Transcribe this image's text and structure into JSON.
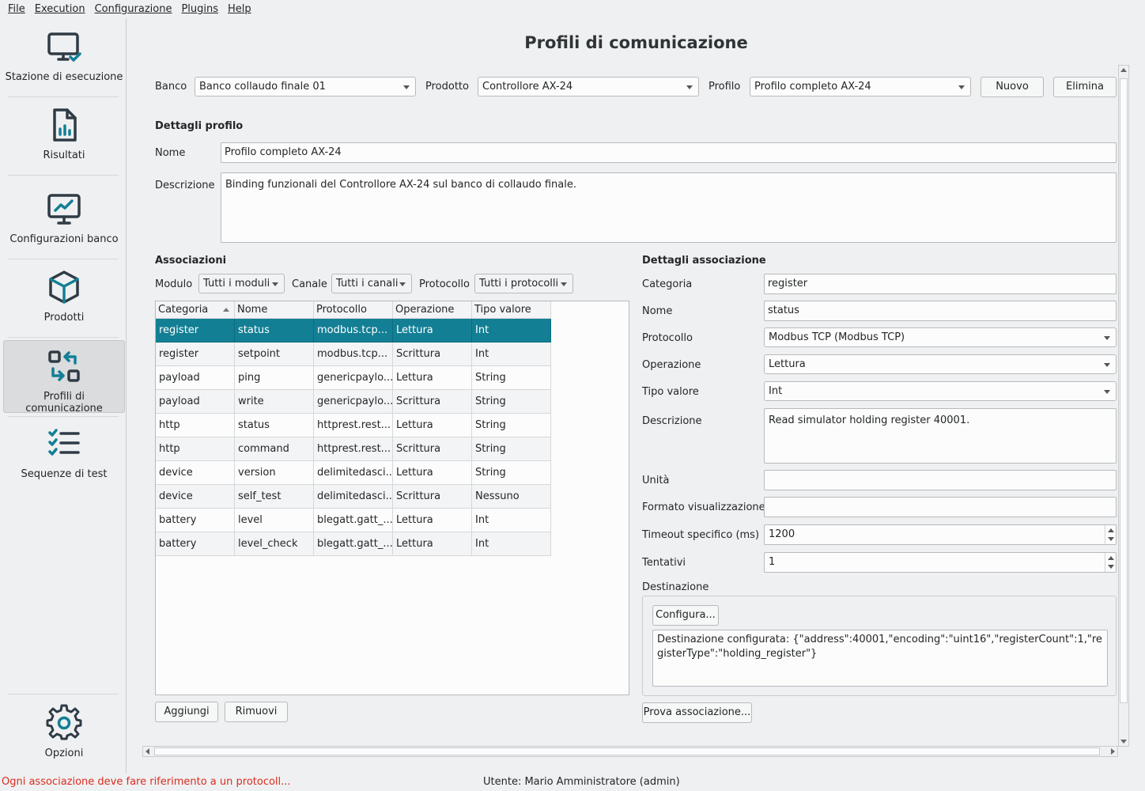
{
  "menu": [
    "File",
    "Execution",
    "Configurazione",
    "Plugins",
    "Help"
  ],
  "sidebar": {
    "items": [
      {
        "label": "Stazione di esecuzione",
        "icon": "monitor-check-icon"
      },
      {
        "label": "Risultati",
        "icon": "report-file-icon"
      },
      {
        "label": "Configurazioni banco",
        "icon": "monitor-chart-icon"
      },
      {
        "label": "Prodotti",
        "icon": "cube-icon"
      },
      {
        "label": "Profili di comunicazione",
        "icon": "swap-arrows-icon",
        "active": true
      },
      {
        "label": "Sequenze di test",
        "icon": "checklist-icon"
      }
    ],
    "options": {
      "label": "Opzioni",
      "icon": "gear-icon"
    }
  },
  "page": {
    "title": "Profili di comunicazione"
  },
  "selectors": {
    "banco_label": "Banco",
    "banco_value": "Banco collaudo finale 01",
    "prodotto_label": "Prodotto",
    "prodotto_value": "Controllore AX-24",
    "profilo_label": "Profilo",
    "profilo_value": "Profilo completo AX-24",
    "nuovo": "Nuovo",
    "elimina": "Elimina"
  },
  "profile_details": {
    "title": "Dettagli profilo",
    "nome_label": "Nome",
    "nome_value": "Profilo completo AX-24",
    "descrizione_label": "Descrizione",
    "descrizione_value": "Binding funzionali del Controllore AX-24 sul banco di collaudo finale."
  },
  "associations": {
    "title": "Associazioni",
    "filters": {
      "modulo_label": "Modulo",
      "modulo_value": "Tutti i moduli",
      "canale_label": "Canale",
      "canale_value": "Tutti i canali",
      "protocollo_label": "Protocollo",
      "protocollo_value": "Tutti i protocolli"
    },
    "columns": [
      "Categoria",
      "Nome",
      "Protocollo",
      "Operazione",
      "Tipo valore"
    ],
    "rows": [
      [
        "register",
        "status",
        "modbus.tcp...",
        "Lettura",
        "Int"
      ],
      [
        "register",
        "setpoint",
        "modbus.tcp...",
        "Scrittura",
        "Int"
      ],
      [
        "payload",
        "ping",
        "genericpaylo...",
        "Lettura",
        "String"
      ],
      [
        "payload",
        "write",
        "genericpaylo...",
        "Scrittura",
        "String"
      ],
      [
        "http",
        "status",
        "httprest.rest...",
        "Lettura",
        "String"
      ],
      [
        "http",
        "command",
        "httprest.rest...",
        "Scrittura",
        "String"
      ],
      [
        "device",
        "version",
        "delimitedasci...",
        "Lettura",
        "String"
      ],
      [
        "device",
        "self_test",
        "delimitedasci...",
        "Scrittura",
        "Nessuno"
      ],
      [
        "battery",
        "level",
        "blegatt.gatt_...",
        "Lettura",
        "Int"
      ],
      [
        "battery",
        "level_check",
        "blegatt.gatt_...",
        "Lettura",
        "Int"
      ]
    ],
    "selected_row": 0,
    "aggiungi": "Aggiungi",
    "rimuovi": "Rimuovi"
  },
  "association_details": {
    "title": "Dettagli associazione",
    "categoria_label": "Categoria",
    "categoria_value": "register",
    "nome_label": "Nome",
    "nome_value": "status",
    "protocollo_label": "Protocollo",
    "protocollo_value": "Modbus TCP (Modbus TCP)",
    "operazione_label": "Operazione",
    "operazione_value": "Lettura",
    "tipo_label": "Tipo valore",
    "tipo_value": "Int",
    "descrizione_label": "Descrizione",
    "descrizione_value": "Read simulator holding register 40001.",
    "unita_label": "Unità",
    "unita_value": "",
    "formato_label": "Formato visualizzazione",
    "formato_value": "",
    "timeout_label": "Timeout specifico (ms)",
    "timeout_value": "1200",
    "tentativi_label": "Tentativi",
    "tentativi_value": "1",
    "destinazione_label": "Destinazione",
    "configura": "Configura...",
    "destinazione_value": "Destinazione configurata: {\"address\":40001,\"encoding\":\"uint16\",\"registerCount\":1,\"registerType\":\"holding_register\"}",
    "prova": "Prova associazione..."
  },
  "status": {
    "error": "Ogni associazione deve fare riferimento a un protocoll...",
    "user": "Utente: Mario Amministratore (admin)"
  },
  "colors": {
    "accent": "#137f95",
    "error": "#da2c20",
    "icon": "#2f3b45"
  }
}
